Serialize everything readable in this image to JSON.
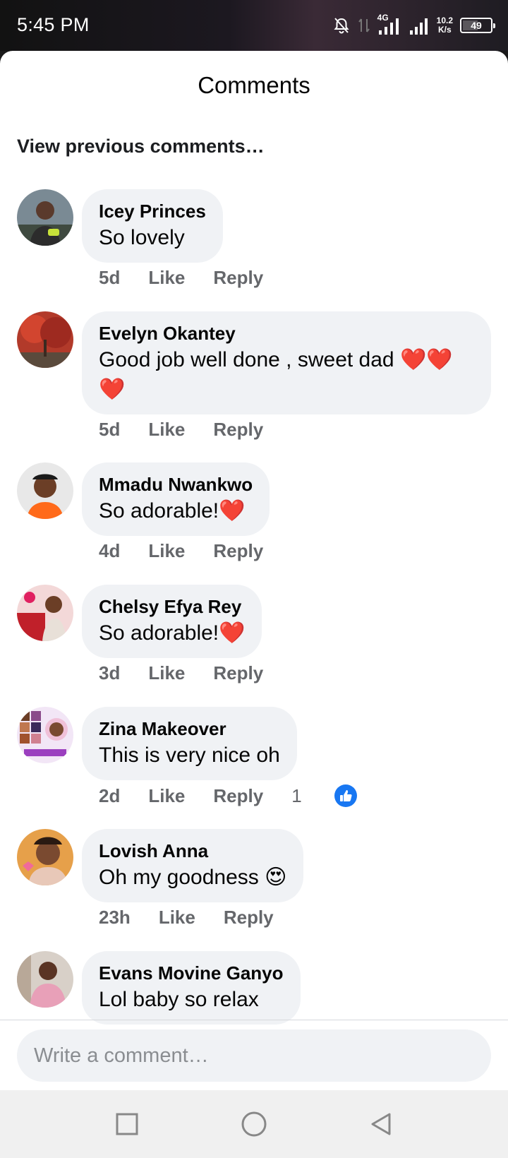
{
  "status_bar": {
    "time": "5:45 PM",
    "network_type": "4G",
    "speed_value": "10.2",
    "speed_unit": "K/s",
    "battery": "49"
  },
  "header": {
    "title": "Comments",
    "view_previous": "View previous comments…"
  },
  "comments": [
    {
      "author": "Icey Princes",
      "text": "So lovely",
      "time": "5d",
      "like_label": "Like",
      "reply_label": "Reply"
    },
    {
      "author": "Evelyn Okantey",
      "text": "Good job well done , sweet dad ❤️❤️❤️",
      "time": "5d",
      "like_label": "Like",
      "reply_label": "Reply"
    },
    {
      "author": "Mmadu Nwankwo",
      "text": "So adorable!❤️",
      "time": "4d",
      "like_label": "Like",
      "reply_label": "Reply"
    },
    {
      "author": "Chelsy Efya Rey",
      "text": "So adorable!❤️",
      "time": "3d",
      "like_label": "Like",
      "reply_label": "Reply"
    },
    {
      "author": "Zina Makeover",
      "text": "This is very nice oh",
      "time": "2d",
      "like_label": "Like",
      "reply_label": "Reply",
      "reaction_count": "1",
      "reaction_icon": "thumbs-up-icon"
    },
    {
      "author": "Lovish Anna",
      "text": "Oh my goodness 😍",
      "time": "23h",
      "like_label": "Like",
      "reply_label": "Reply"
    },
    {
      "author": "Evans Movine Ganyo",
      "text": "Lol baby so relax",
      "time": "",
      "like_label": "",
      "reply_label": ""
    }
  ],
  "composer": {
    "placeholder": "Write a comment…"
  },
  "nav_bar": {
    "icons": [
      "recent-apps-icon",
      "home-icon",
      "back-icon"
    ]
  },
  "colors": {
    "bubble": "#f0f2f5",
    "meta_text": "#65676b",
    "like_blue": "#1877f2"
  }
}
